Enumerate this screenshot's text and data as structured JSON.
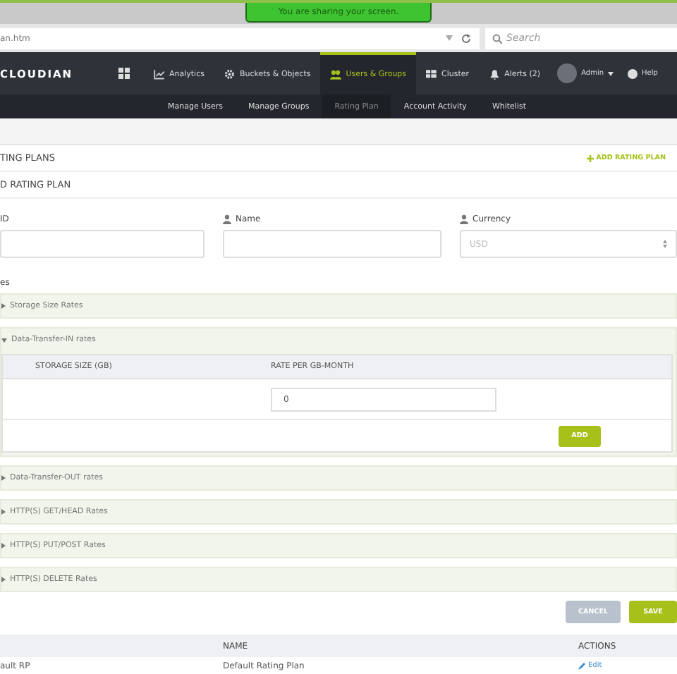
{
  "share_banner": "You are sharing your screen.",
  "browser": {
    "url": "an.htm",
    "search_placeholder": "Search"
  },
  "nav": {
    "logo": "CLOUDIAN",
    "items": [
      {
        "label": "Analytics",
        "selected": false
      },
      {
        "label": "Buckets & Objects",
        "selected": false
      },
      {
        "label": "Users & Groups",
        "selected": true
      },
      {
        "label": "Cluster",
        "selected": false
      },
      {
        "label": "Alerts (2)",
        "selected": false
      }
    ],
    "user": "Admin",
    "help": "Help"
  },
  "subnav": [
    {
      "label": "Manage Users",
      "selected": false
    },
    {
      "label": "Manage Groups",
      "selected": false
    },
    {
      "label": "Rating Plan",
      "selected": true
    },
    {
      "label": "Account Activity",
      "selected": false
    },
    {
      "label": "Whitelist",
      "selected": false
    }
  ],
  "page_title": "TING PLANS",
  "add_link": "ADD RATING PLAN",
  "form_title": "D RATING PLAN",
  "fields": [
    {
      "label": "ID",
      "kind": "text"
    },
    {
      "label": "Name",
      "kind": "text"
    },
    {
      "label": "Currency",
      "kind": "select",
      "value": "USD"
    }
  ],
  "rates_title": "es",
  "sections": [
    {
      "title": "Storage Size Rates",
      "expanded": false
    },
    {
      "title": "Data-Transfer-IN rates",
      "expanded": true,
      "columns": [
        "STORAGE SIZE (GB)",
        "RATE PER GB-MONTH"
      ],
      "rate_value": "0",
      "add_button": "ADD"
    },
    {
      "title": "Data-Transfer-OUT rates",
      "expanded": false
    },
    {
      "title": "HTTP(S) GET/HEAD Rates",
      "expanded": false
    },
    {
      "title": "HTTP(S) PUT/POST Rates",
      "expanded": false
    },
    {
      "title": "HTTP(S) DELETE Rates",
      "expanded": false
    }
  ],
  "buttons": {
    "cancel": "CANCEL",
    "save": "SAVE"
  },
  "plans_table": {
    "columns": [
      "",
      "NAME",
      "ACTIONS"
    ],
    "rows": [
      {
        "id": "ault RP",
        "name": "Default Rating Plan",
        "action": "Edit"
      }
    ]
  }
}
